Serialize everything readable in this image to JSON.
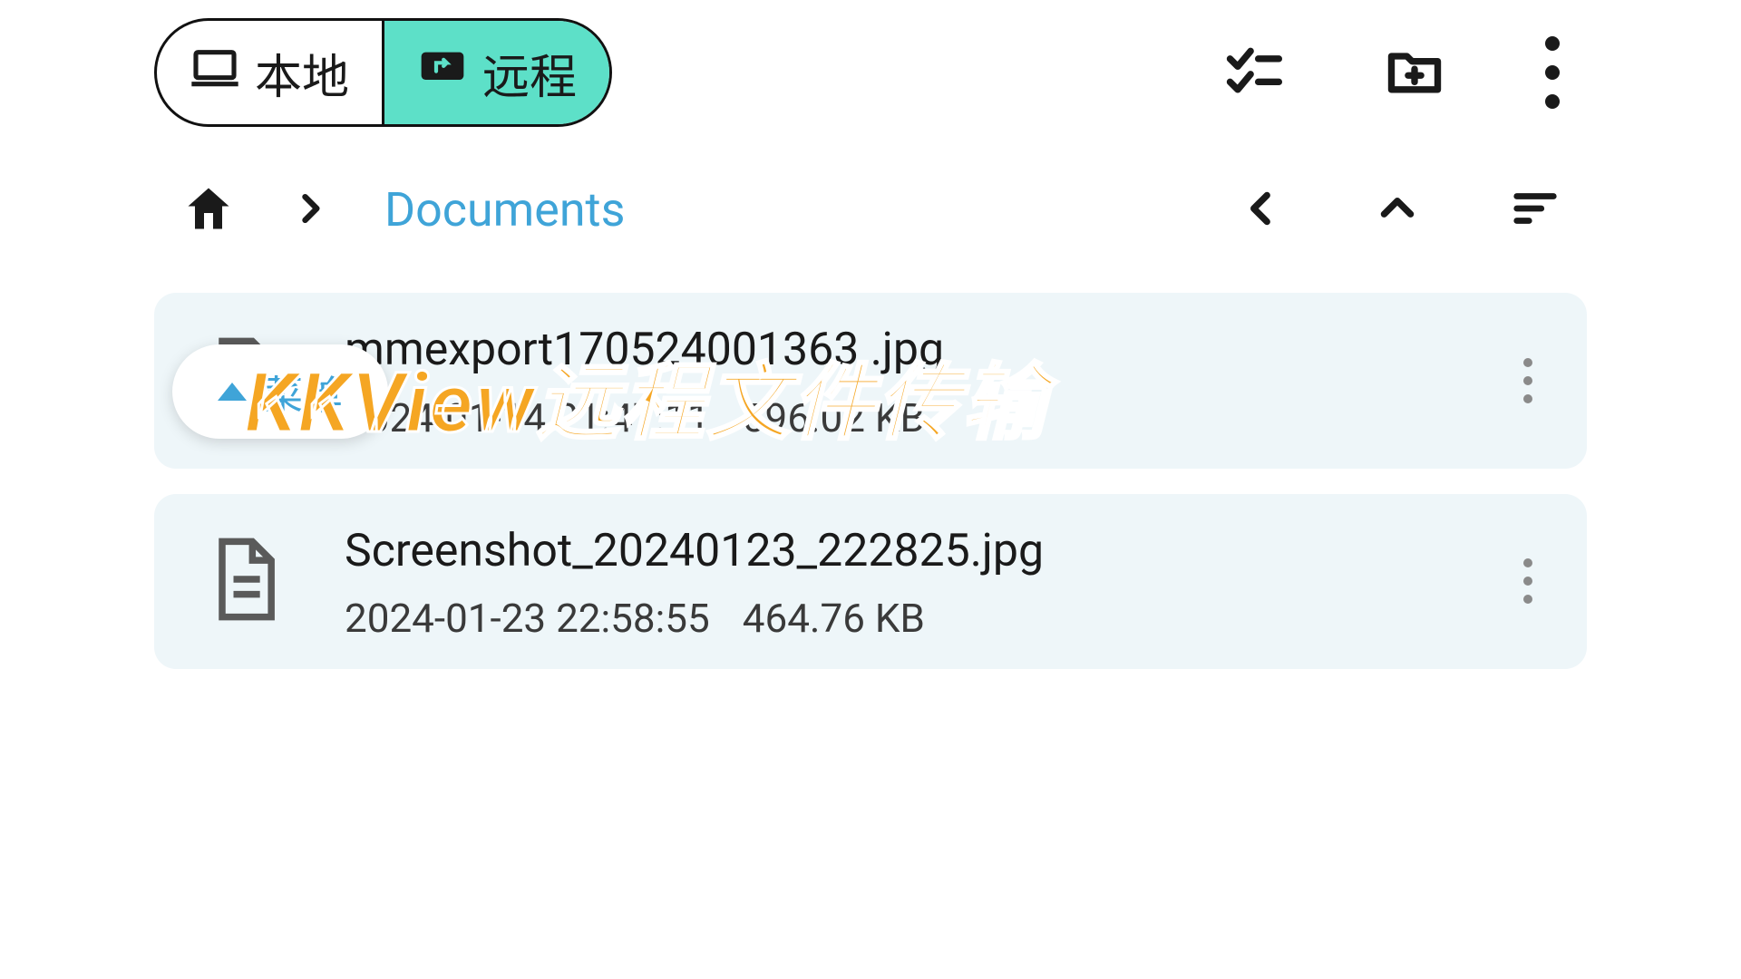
{
  "toggle": {
    "local_label": "本地",
    "remote_label": "远程"
  },
  "breadcrumb": {
    "current": "Documents"
  },
  "menu_chip": {
    "label": "菜单"
  },
  "files": [
    {
      "name": "mmexport170524001363 .jpg",
      "date": "2024-01-14 21:47:11",
      "size": "596.02 KB"
    },
    {
      "name": "Screenshot_20240123_222825.jpg",
      "date": "2024-01-23 22:58:55",
      "size": "464.76 KB"
    }
  ],
  "watermark": "KKView远程文件传输"
}
